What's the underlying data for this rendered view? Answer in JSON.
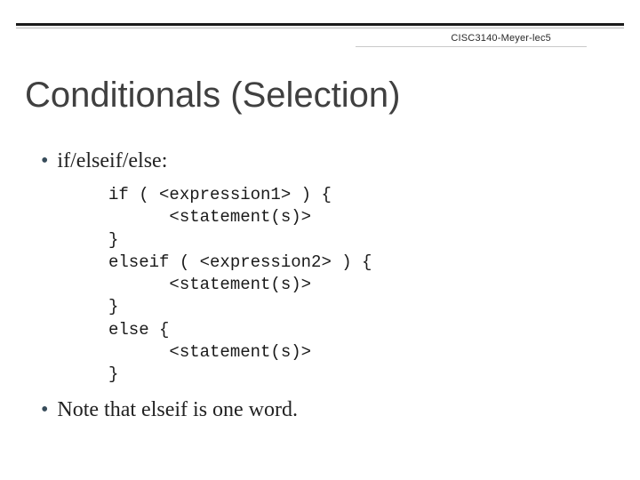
{
  "header": {
    "tag": "CISC3140-Meyer-lec5"
  },
  "title": "Conditionals (Selection)",
  "bullets": {
    "first": "if/elseif/else:",
    "second": "Note that elseif is one word."
  },
  "code": "if ( <expression1> ) {\n      <statement(s)>\n}\nelseif ( <expression2> ) {\n      <statement(s)>\n}\nelse {\n      <statement(s)>\n}"
}
